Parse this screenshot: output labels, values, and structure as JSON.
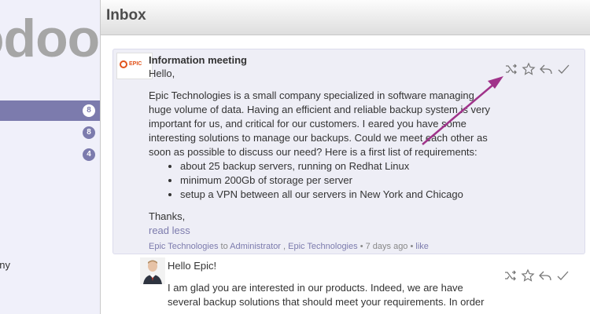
{
  "sidebar": {
    "logo": "odoo",
    "items": [
      {
        "badge": "8",
        "active": true
      },
      {
        "badge": "8",
        "active": false
      },
      {
        "badge": "4",
        "active": false
      }
    ],
    "company_label": "any"
  },
  "header": {
    "title": "Inbox"
  },
  "messages": [
    {
      "subject": "Information meeting",
      "avatar_label": "EPIC",
      "greeting": "Hello,",
      "paragraph": "Epic Technologies is a small company specialized in software managing huge volume of data. Having an efficient and reliable backup system is very important for us, and critical for our customers. I eared you have some interesting solutions to manage our backups. Could we meet each other as soon as possible to discuss our need? Here is a first list of requirements:",
      "requirements": [
        "about 25 backup servers, running on Redhat Linux",
        "minimum 200Gb of storage per server",
        "setup a VPN between all our servers in New York and Chicago"
      ],
      "closing": "Thanks,",
      "read_less": "read less",
      "footer": {
        "author": "Epic Technologies",
        "to": "to",
        "recipient": "Administrator",
        "sep1": ",",
        "partner": "Epic Technologies",
        "dot1": "•",
        "date": "7 days ago",
        "dot2": "•",
        "like": "like"
      }
    },
    {
      "greeting": "Hello Epic!",
      "paragraph_partial": "I am glad you are interested in our products. Indeed, we are have several backup solutions that should meet your requirements. In order"
    }
  ],
  "icons": [
    "shuffle-icon",
    "star-icon",
    "reply-icon",
    "checkmark-icon"
  ],
  "colors": {
    "accent": "#7c7bad",
    "arrow": "#a0338a",
    "message_bg": "#eeeef6"
  }
}
